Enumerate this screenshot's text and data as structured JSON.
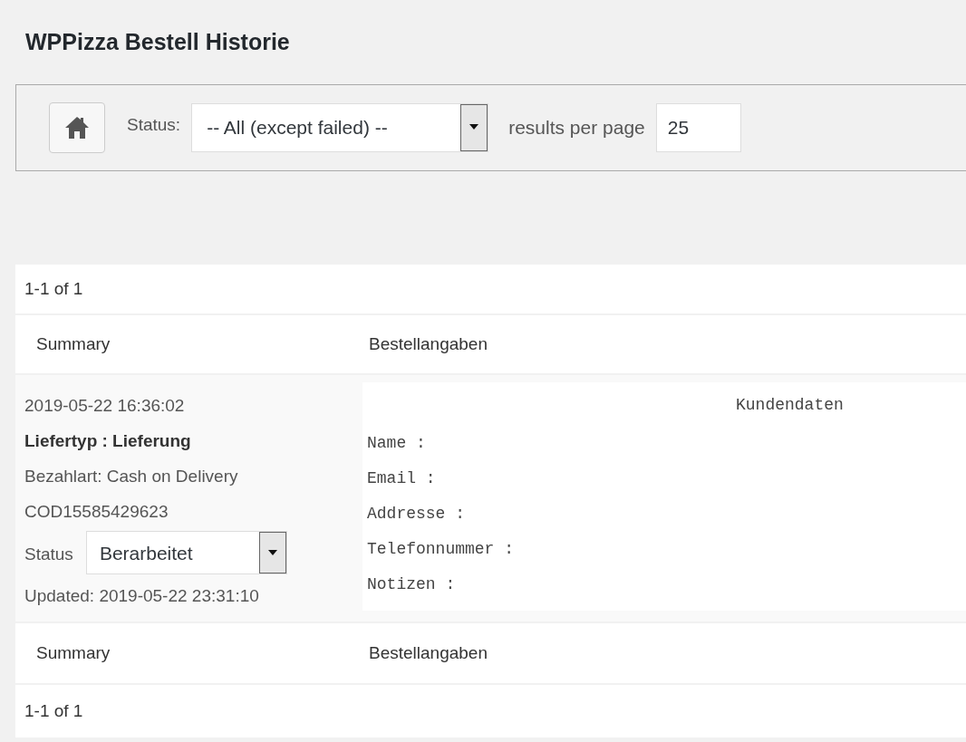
{
  "page_title": "WPPizza Bestell Historie",
  "filter": {
    "status_label": "Status:",
    "status_value": "-- All (except failed) --",
    "per_page_label": "results per page",
    "per_page_value": "25"
  },
  "pagination_top": "1-1 of 1",
  "columns": [
    "Summary",
    "Bestellangaben"
  ],
  "orders": [
    {
      "date": "2019-05-22 16:36:02",
      "delivery": "Liefertyp : Lieferung",
      "payment": "Bezahlart: Cash on Delivery",
      "transaction": "COD15585429623",
      "status_label": "Status",
      "status_value": "Berarbeitet",
      "updated": "Updated: 2019-05-22 23:31:10",
      "details_heading": "Kundendaten",
      "details": [
        "Name :",
        "Email :",
        "Addresse :",
        "Telefonnummer :",
        "Notizen :"
      ]
    }
  ],
  "columns_footer": [
    "Summary",
    "Bestellangaben"
  ],
  "pagination_bottom": "1-1 of 1"
}
